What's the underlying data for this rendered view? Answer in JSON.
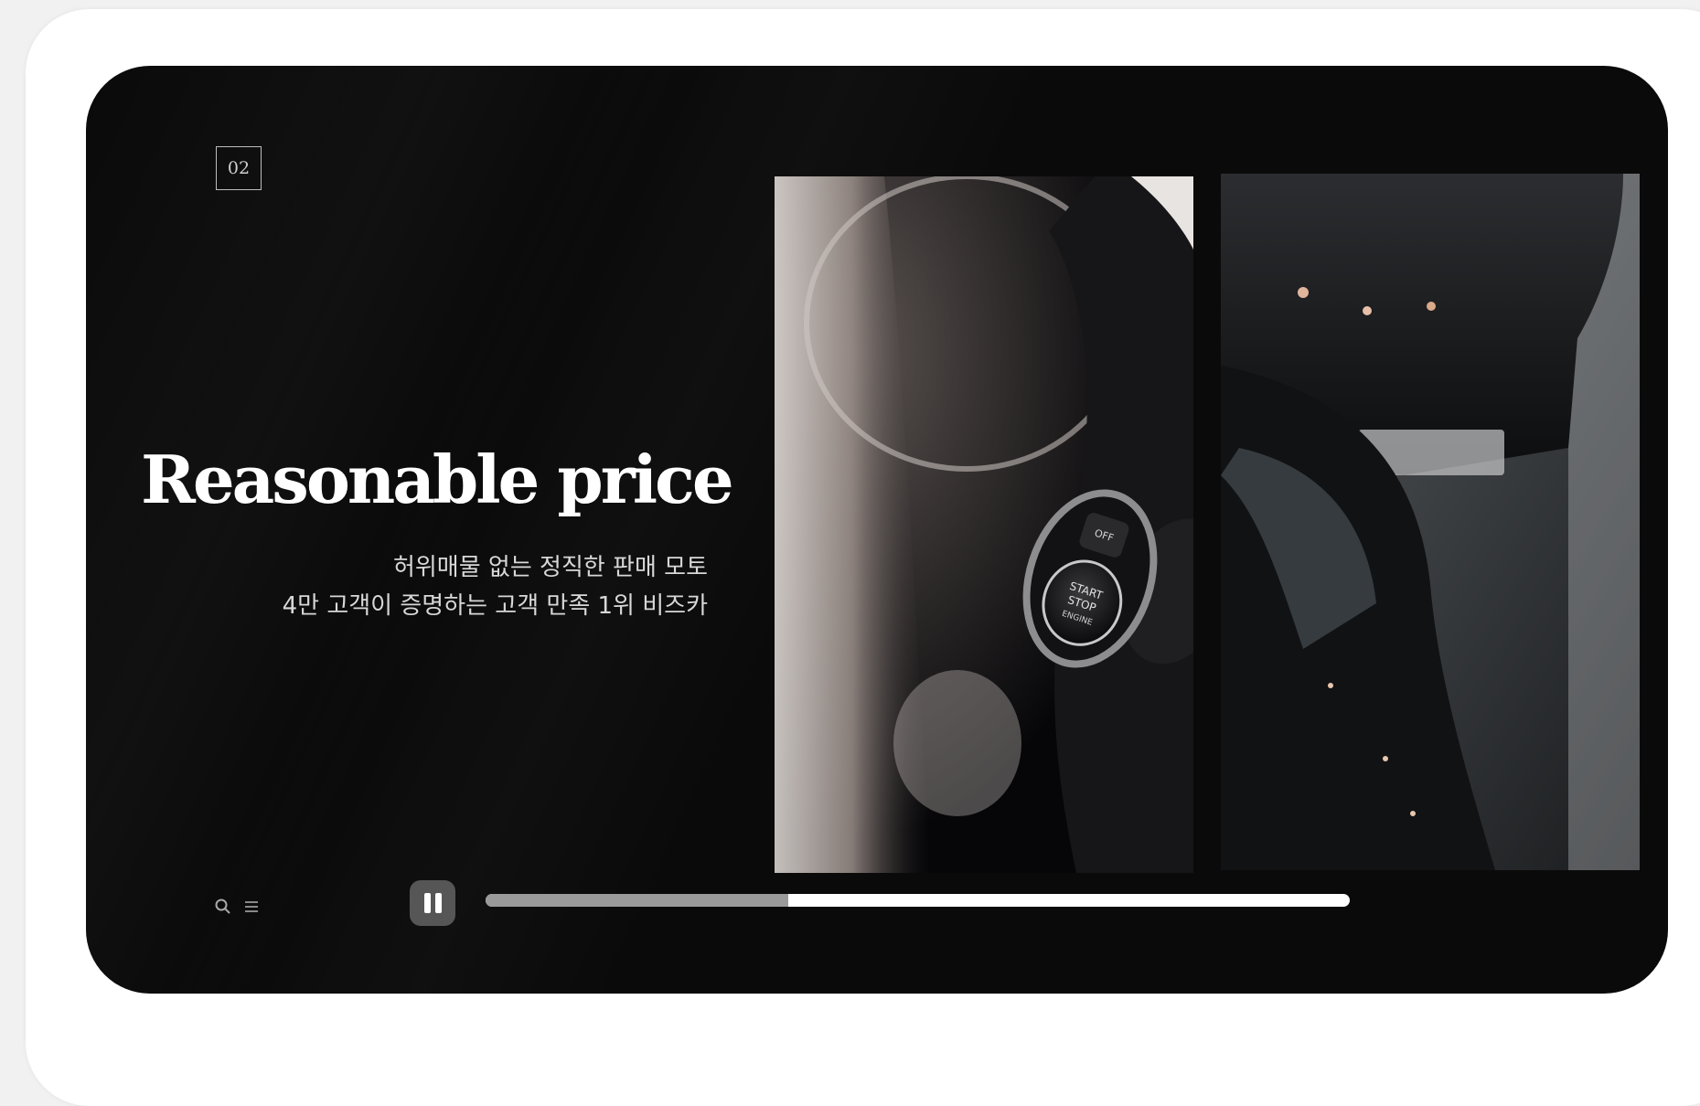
{
  "slide": {
    "number": "02",
    "headline": "Reasonable price",
    "subtitle_line1": "허위매물 없는 정직한 판매 모토",
    "subtitle_line2": "4만 고객이 증명하는 고객 만족 1위 비즈카"
  },
  "images": [
    {
      "name": "car-start-stop-button-photo",
      "button_text": [
        "START",
        "STOP",
        "ENGINE"
      ],
      "small_label": "OFF"
    },
    {
      "name": "parked-black-cars-photo"
    }
  ],
  "controls": {
    "search_icon": "search-icon",
    "menu_icon": "menu-icon",
    "pause_icon": "pause-icon",
    "progress": 0.35
  },
  "colors": {
    "hero_background": "#0a0a0a",
    "progress_track": "#ffffff",
    "progress_fill": "#9a9a9a",
    "pause_button": "#565656"
  }
}
